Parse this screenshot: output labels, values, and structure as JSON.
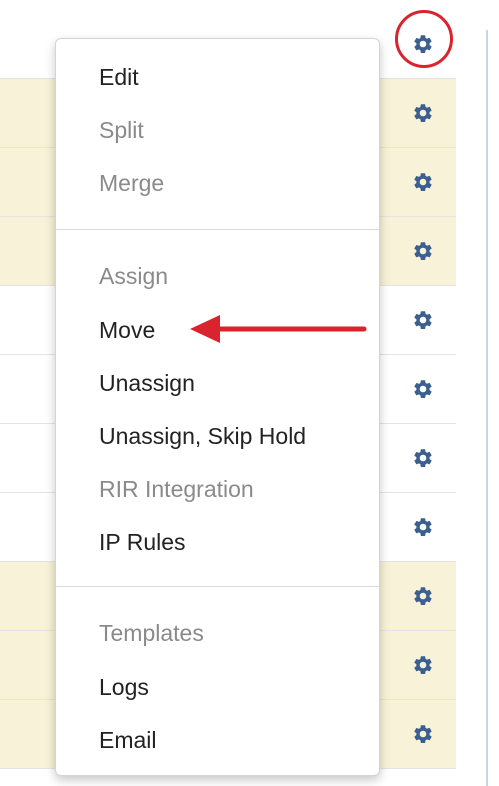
{
  "colors": {
    "row_highlight": "#f7f2d8",
    "gear_icon": "#3b5f8f",
    "annotation_red": "#d9232d",
    "menu_text": "#222222",
    "menu_text_disabled": "#8a8a8a"
  },
  "table": {
    "rows": [
      {
        "highlight": false,
        "icon": "gear-icon"
      },
      {
        "highlight": true,
        "icon": "gear-icon"
      },
      {
        "highlight": true,
        "icon": "gear-icon"
      },
      {
        "highlight": true,
        "icon": "gear-icon"
      },
      {
        "highlight": false,
        "icon": "gear-icon"
      },
      {
        "highlight": false,
        "icon": "gear-icon"
      },
      {
        "highlight": false,
        "icon": "gear-icon"
      },
      {
        "highlight": false,
        "icon": "gear-icon"
      },
      {
        "highlight": true,
        "icon": "gear-icon"
      },
      {
        "highlight": true,
        "icon": "gear-icon"
      },
      {
        "highlight": true,
        "icon": "gear-icon"
      }
    ]
  },
  "menu": {
    "edit": "Edit",
    "split": "Split",
    "merge": "Merge",
    "assign": "Assign",
    "move": "Move",
    "unassign": "Unassign",
    "unassign_skip_hold": "Unassign, Skip Hold",
    "rir_integration": "RIR Integration",
    "ip_rules": "IP Rules",
    "templates": "Templates",
    "logs": "Logs",
    "email": "Email"
  },
  "annotations": {
    "circle_target": "gear-icon",
    "arrow_target": "Move"
  }
}
